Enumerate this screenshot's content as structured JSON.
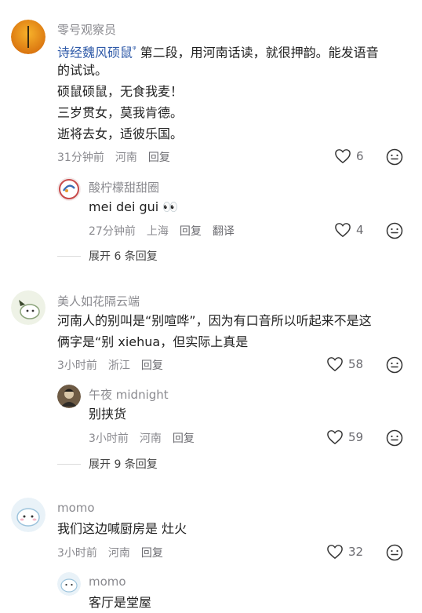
{
  "comments": [
    {
      "name": "零号观察员",
      "link": "诗经魏风硕鼠",
      "line1_rest": " 第二段，用河南话读，就很押韵。能发语音",
      "line2": "的试试。",
      "line3": "硕鼠硕鼠，无食我麦！",
      "line4": "三岁贯女，莫我肯德。",
      "line5": "逝将去女，适彼乐国。",
      "time": "31分钟前",
      "location": "河南",
      "reply_label": "回复",
      "likes": "6",
      "reply": {
        "name": "酸柠檬甜甜圈",
        "text": "mei dei gui 👀",
        "time": "27分钟前",
        "location": "上海",
        "reply_label": "回复",
        "translate_label": "翻译",
        "likes": "4"
      },
      "expand": "展开 6 条回复"
    },
    {
      "name": "美人如花隔云端",
      "line1": "河南人的别叫是“别喧哗”，因为有口音所以听起来不是这",
      "line2": "俩字是“别 xiehua，但实际上真是",
      "time": "3小时前",
      "location": "浙江",
      "reply_label": "回复",
      "likes": "58",
      "reply": {
        "name": "午夜 midnight",
        "text": "别挟货",
        "time": "3小时前",
        "location": "河南",
        "reply_label": "回复",
        "likes": "59"
      },
      "expand": "展开 9 条回复"
    },
    {
      "name": "momo",
      "line1": "我们这边喊厨房是 灶火",
      "time": "3小时前",
      "location": "河南",
      "reply_label": "回复",
      "likes": "32",
      "reply": {
        "name": "momo",
        "text": "客厅是堂屋"
      }
    }
  ],
  "colors": {
    "name": "#8a8a8f",
    "link": "#2f5aa8",
    "text": "#1f1f1f"
  },
  "icons": [
    "heart-outline-icon",
    "emoji-face-icon",
    "search-mini-icon"
  ]
}
